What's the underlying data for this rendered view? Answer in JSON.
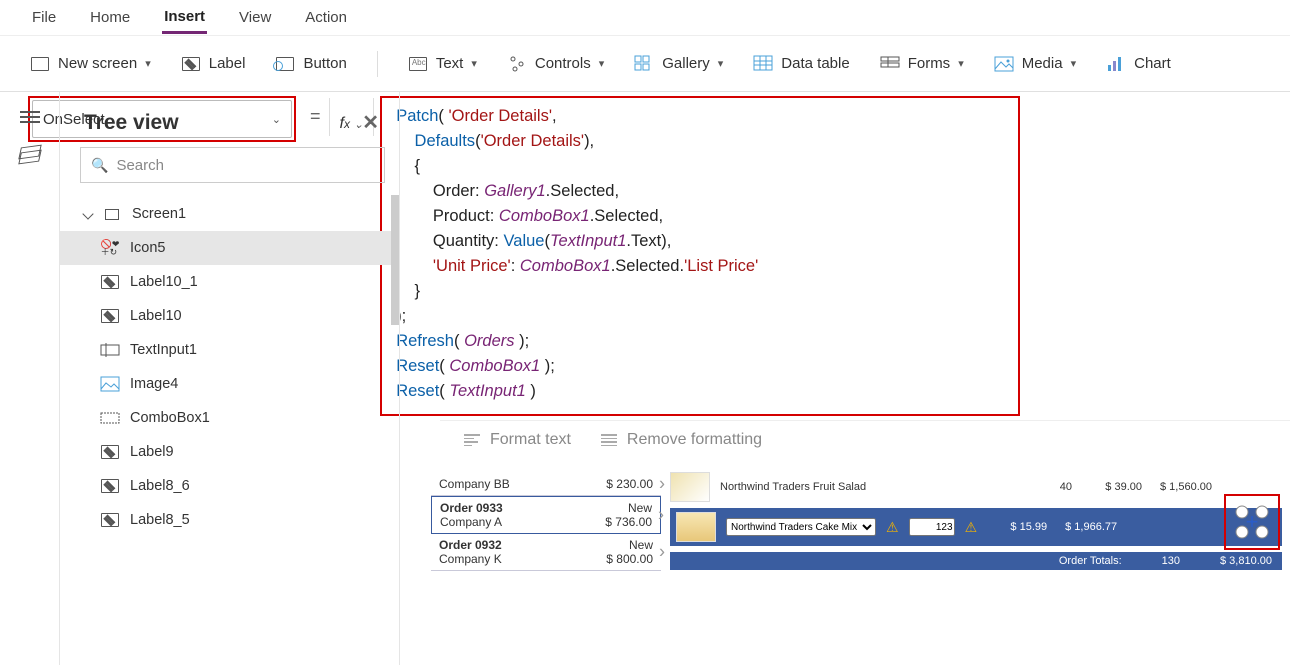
{
  "menubar": {
    "items": [
      "File",
      "Home",
      "Insert",
      "View",
      "Action"
    ],
    "active": "Insert"
  },
  "ribbon": {
    "new_screen": "New screen",
    "label": "Label",
    "button": "Button",
    "text": "Text",
    "controls": "Controls",
    "gallery": "Gallery",
    "data_table": "Data table",
    "forms": "Forms",
    "media": "Media",
    "chart": "Chart"
  },
  "property_dd": "OnSelect",
  "formula_tokens": [
    [
      {
        "t": "fn",
        "v": "Patch"
      },
      {
        "t": "plain",
        "v": "( "
      },
      {
        "t": "str",
        "v": "'Order Details'"
      },
      {
        "t": "plain",
        "v": ","
      }
    ],
    [
      {
        "t": "plain",
        "v": "    "
      },
      {
        "t": "fn",
        "v": "Defaults"
      },
      {
        "t": "plain",
        "v": "("
      },
      {
        "t": "str",
        "v": "'Order Details'"
      },
      {
        "t": "plain",
        "v": "),"
      }
    ],
    [
      {
        "t": "plain",
        "v": "    {"
      }
    ],
    [
      {
        "t": "plain",
        "v": "        Order: "
      },
      {
        "t": "obj",
        "v": "Gallery1"
      },
      {
        "t": "plain",
        "v": ".Selected,"
      }
    ],
    [
      {
        "t": "plain",
        "v": "        Product: "
      },
      {
        "t": "obj",
        "v": "ComboBox1"
      },
      {
        "t": "plain",
        "v": ".Selected,"
      }
    ],
    [
      {
        "t": "plain",
        "v": "        Quantity: "
      },
      {
        "t": "fn",
        "v": "Value"
      },
      {
        "t": "plain",
        "v": "("
      },
      {
        "t": "obj",
        "v": "TextInput1"
      },
      {
        "t": "plain",
        "v": ".Text),"
      }
    ],
    [
      {
        "t": "plain",
        "v": "        "
      },
      {
        "t": "str",
        "v": "'Unit Price'"
      },
      {
        "t": "plain",
        "v": ": "
      },
      {
        "t": "obj",
        "v": "ComboBox1"
      },
      {
        "t": "plain",
        "v": ".Selected."
      },
      {
        "t": "str",
        "v": "'List Price'"
      }
    ],
    [
      {
        "t": "plain",
        "v": "    }"
      }
    ],
    [
      {
        "t": "plain",
        "v": ");"
      }
    ],
    [
      {
        "t": "fn",
        "v": "Refresh"
      },
      {
        "t": "plain",
        "v": "( "
      },
      {
        "t": "obj",
        "v": "Orders"
      },
      {
        "t": "plain",
        "v": " );"
      }
    ],
    [
      {
        "t": "fn",
        "v": "Reset"
      },
      {
        "t": "plain",
        "v": "( "
      },
      {
        "t": "obj",
        "v": "ComboBox1"
      },
      {
        "t": "plain",
        "v": " );"
      }
    ],
    [
      {
        "t": "fn",
        "v": "Reset"
      },
      {
        "t": "plain",
        "v": "( "
      },
      {
        "t": "obj",
        "v": "TextInput1"
      },
      {
        "t": "plain",
        "v": " )"
      }
    ]
  ],
  "fmt_text": "Format text",
  "fmt_remove": "Remove formatting",
  "treeview": {
    "title": "Tree view",
    "search_ph": "Search",
    "root": "Screen1",
    "items": [
      "Icon5",
      "Label10_1",
      "Label10",
      "TextInput1",
      "Image4",
      "ComboBox1",
      "Label9",
      "Label8_6",
      "Label8_5"
    ],
    "selected": "Icon5"
  },
  "canvas": {
    "orders": [
      {
        "l1": "Company BB",
        "r1": "$ 230.00",
        "single": true
      },
      {
        "l1": "Order 0933",
        "l2": "Company A",
        "r1": "New",
        "r2": "$ 736.00",
        "sel": true
      },
      {
        "l1": "Order 0932",
        "l2": "Company K",
        "r1": "New",
        "r2": "$ 800.00"
      }
    ],
    "detail_row": {
      "name": "Northwind Traders Fruit Salad",
      "qty": "40",
      "price": "$ 39.00",
      "line": "$ 1,560.00"
    },
    "edit_row": {
      "name": "Northwind Traders Cake Mix",
      "qty": "123",
      "price": "$ 15.99",
      "line": "$ 1,966.77"
    },
    "totals": {
      "label": "Order Totals:",
      "qty": "130",
      "sum": "$ 3,810.00"
    }
  }
}
